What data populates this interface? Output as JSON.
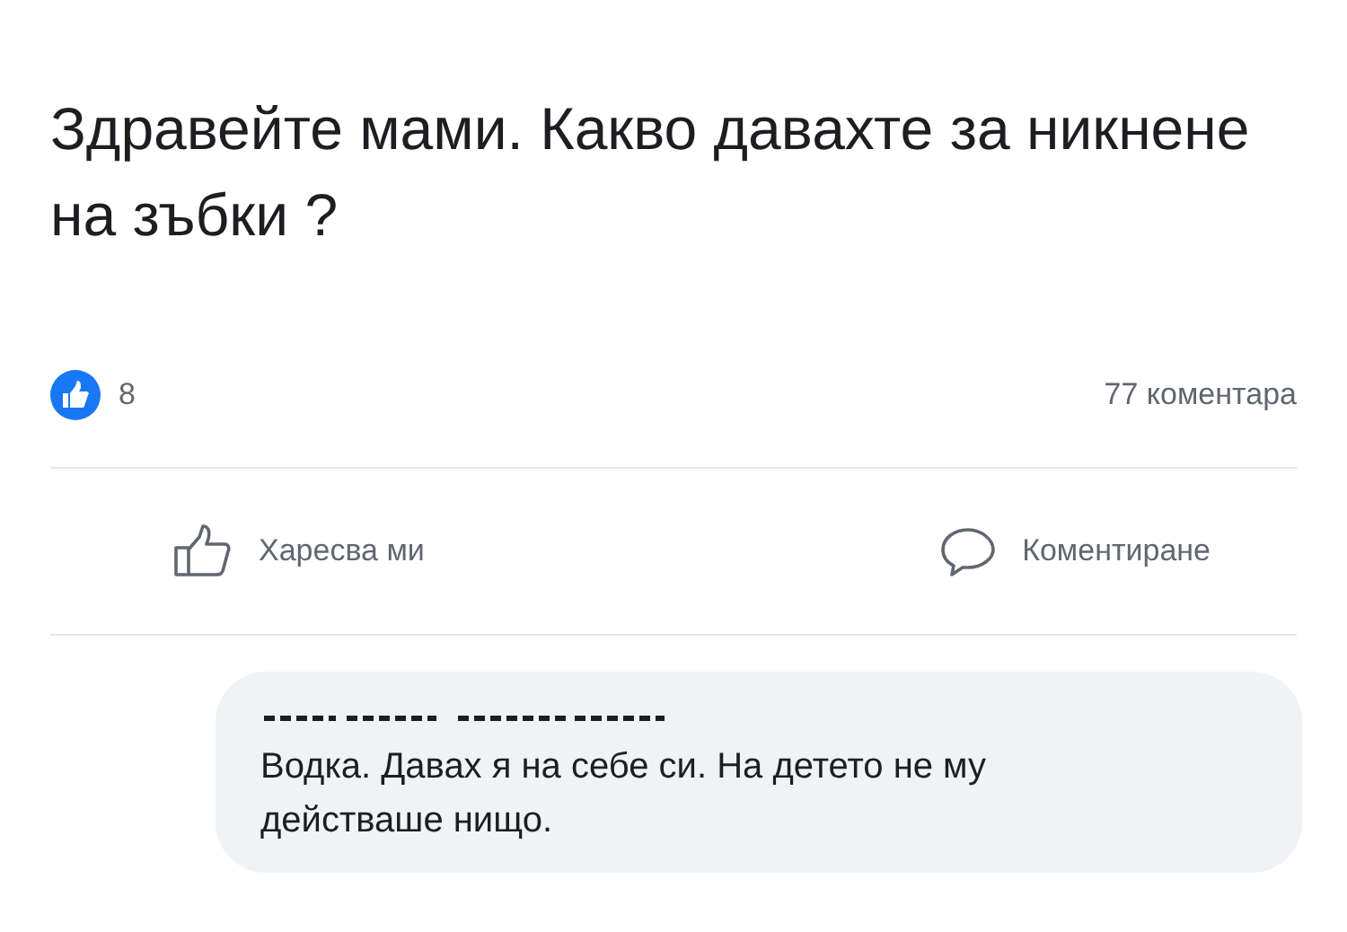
{
  "post": {
    "text": "Здравейте мами. Какво давахте за никнене на зъбки ?"
  },
  "reactions": {
    "count": "8",
    "comments": "77 коментара"
  },
  "actions": [
    {
      "kind": "like",
      "label": "Харесва ми"
    },
    {
      "kind": "comment",
      "label": "Коментиране"
    }
  ],
  "comment": {
    "text": "Водка. Давах я на себе си. На детето не му действаше нищо."
  }
}
